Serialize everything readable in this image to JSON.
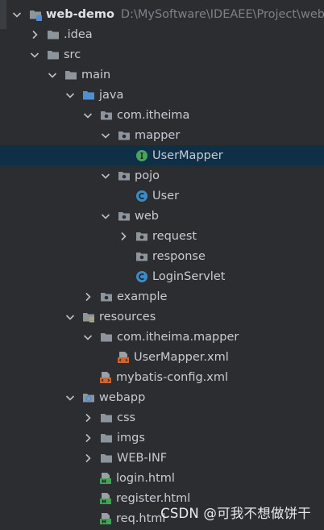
{
  "project_tree": {
    "root": {
      "label": "web-demo",
      "path": "D:\\MySoftware\\IDEAEE\\Project\\web"
    },
    "idea": {
      "label": ".idea"
    },
    "src": {
      "label": "src"
    },
    "main": {
      "label": "main"
    },
    "java": {
      "label": "java"
    },
    "com_itheima": {
      "label": "com.itheima"
    },
    "mapper": {
      "label": "mapper"
    },
    "usermapper": {
      "label": "UserMapper"
    },
    "pojo": {
      "label": "pojo"
    },
    "user": {
      "label": "User"
    },
    "web": {
      "label": "web"
    },
    "request": {
      "label": "request"
    },
    "response": {
      "label": "response"
    },
    "loginservlet": {
      "label": "LoginServlet"
    },
    "example": {
      "label": "example"
    },
    "resources": {
      "label": "resources"
    },
    "com_itheima_mapper": {
      "label": "com.itheima.mapper"
    },
    "usermapper_xml": {
      "label": "UserMapper.xml"
    },
    "mybatis_config": {
      "label": "mybatis-config.xml"
    },
    "webapp": {
      "label": "webapp"
    },
    "css": {
      "label": "css"
    },
    "imgs": {
      "label": "imgs"
    },
    "web_inf": {
      "label": "WEB-INF"
    },
    "login_html": {
      "label": "login.html"
    },
    "register_html": {
      "label": "register.html"
    },
    "req_html": {
      "label": "req.html"
    }
  },
  "watermark": {
    "text": "CSDN @可我不想做饼干"
  },
  "colors": {
    "background": "#2b2d30",
    "selection": "#0f2f47",
    "text": "#c8ccd2",
    "path_text": "#7e8288",
    "folder": "#8e949b",
    "source_folder": "#4d8fd2",
    "interface_icon": "#4aa35c",
    "class_icon": "#3e8bc2",
    "xml_icon": "#cc6633",
    "html_icon": "#3fa455"
  },
  "icons": {
    "expanded": "chevron-down-icon",
    "collapsed": "chevron-right-icon",
    "folder": "folder-icon",
    "package": "package-icon",
    "source_folder": "source-folder-icon",
    "resources_folder": "resources-folder-icon",
    "web_folder": "web-folder-icon",
    "interface": "interface-icon",
    "class": "class-icon",
    "xml": "xml-file-icon",
    "html": "html-file-icon"
  }
}
